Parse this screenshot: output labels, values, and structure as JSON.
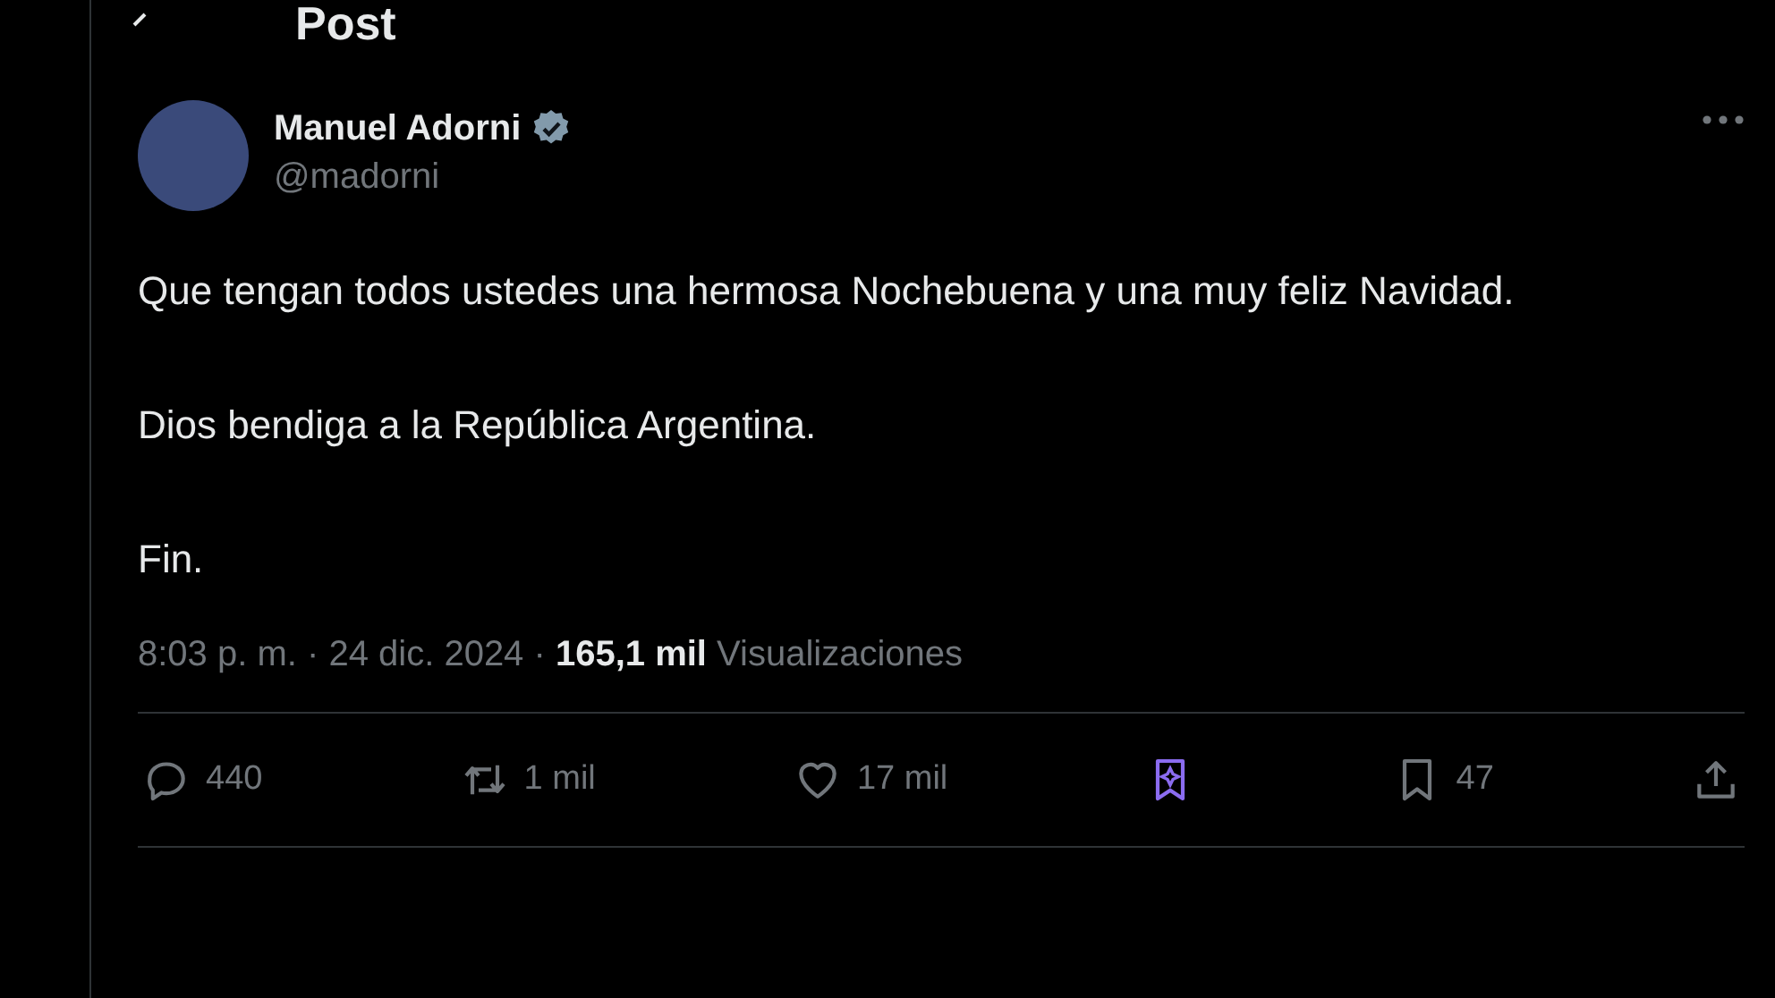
{
  "header": {
    "title": "Post"
  },
  "post": {
    "author": {
      "name": "Manuel Adorni",
      "verified": true,
      "handle": "@madorni"
    },
    "paragraphs": [
      "Que tengan todos ustedes una hermosa Nochebuena y una muy feliz Navidad.",
      "Dios bendiga a la República Argentina.",
      "Fin."
    ],
    "meta": "8:03 p. m. · 24 dic. 2024 · **165,1 mil** Visualizaciones",
    "actions": [
      {
        "kind": "reply",
        "count": "440"
      },
      {
        "kind": "repost",
        "count": "1 mil"
      },
      {
        "kind": "like",
        "count": "17 mil"
      },
      {
        "kind": "grok"
      },
      {
        "kind": "bookmark",
        "count": "47"
      },
      {
        "kind": "share"
      }
    ]
  }
}
